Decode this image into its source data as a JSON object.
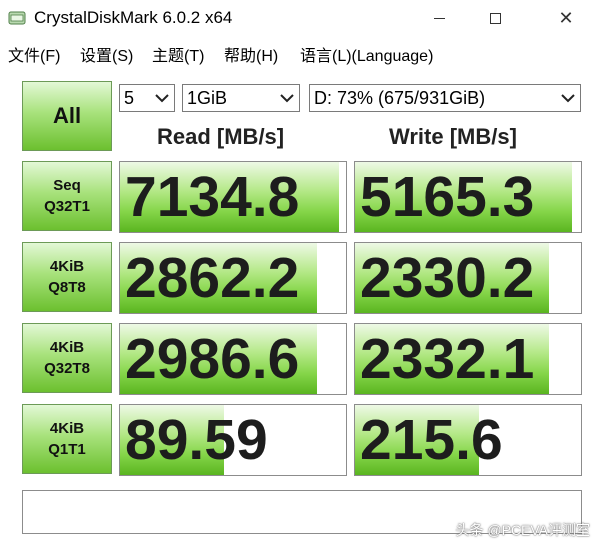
{
  "window": {
    "title": "CrystalDiskMark 6.0.2 x64",
    "close_glyph": "✕"
  },
  "menu": [
    {
      "label": "文件(F)"
    },
    {
      "label": "设置(S)"
    },
    {
      "label": "主题(T)"
    },
    {
      "label": "帮助(H)"
    },
    {
      "label": "语言(L)(Language)"
    }
  ],
  "controls": {
    "all_label": "All",
    "count_value": "5",
    "size_value": "1GiB",
    "drive_value": "D: 73% (675/931GiB)"
  },
  "headers": {
    "read": "Read [MB/s]",
    "write": "Write [MB/s]"
  },
  "rows": [
    {
      "line1": "Seq",
      "line2": "Q32T1",
      "read": "7134.8",
      "write": "5165.3",
      "read_fill": 0.97,
      "write_fill": 0.96
    },
    {
      "line1": "4KiB",
      "line2": "Q8T8",
      "read": "2862.2",
      "write": "2330.2",
      "read_fill": 0.87,
      "write_fill": 0.86
    },
    {
      "line1": "4KiB",
      "line2": "Q32T8",
      "read": "2986.6",
      "write": "2332.1",
      "read_fill": 0.87,
      "write_fill": 0.86
    },
    {
      "line1": "4KiB",
      "line2": "Q1T1",
      "read": "89.59",
      "write": "215.6",
      "read_fill": 0.46,
      "write_fill": 0.55
    }
  ],
  "status": {
    "text": ""
  },
  "watermark": "头条 @PCEVA评测室",
  "colors": {
    "bar_green": "#6cc02f",
    "button_green": "#a8e27c"
  }
}
